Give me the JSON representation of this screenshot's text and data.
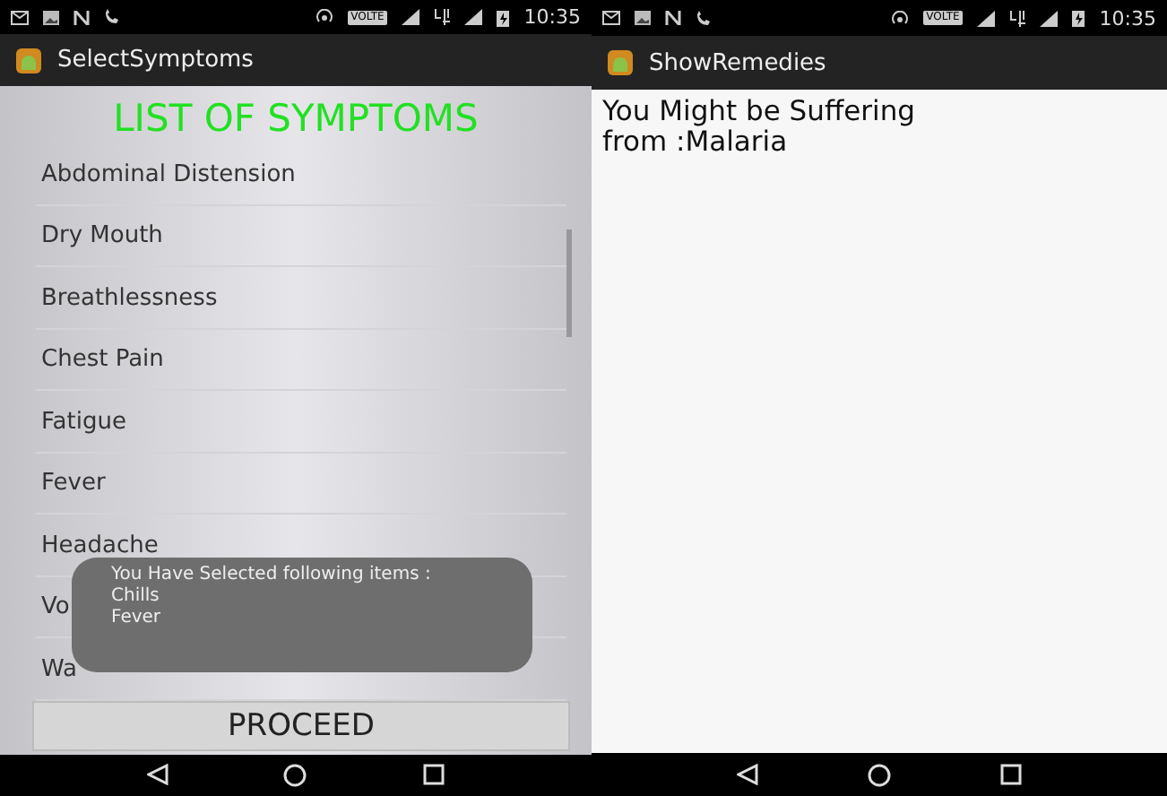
{
  "screens": [
    {
      "kind": "symptoms",
      "status_bar": {
        "badge": "VOLTE",
        "time": "10:35"
      },
      "app_bar": {
        "title": "SelectSymptoms"
      },
      "heading": "LIST OF SYMPTOMS",
      "items": [
        "Abdominal Distension",
        "Dry Mouth",
        "Breathlessness",
        "Chest Pain",
        "Fatigue",
        "Fever",
        "Headache",
        "Vo",
        "Wa"
      ],
      "toast": {
        "lines": [
          "You Have Selected following items  :",
          "Chills",
          "Fever"
        ]
      },
      "button": "PROCEED"
    },
    {
      "kind": "remedies",
      "status_bar": {
        "badge": "VOLTE",
        "time": "10:35"
      },
      "app_bar": {
        "title": "ShowRemedies"
      },
      "message": "You Might be Suffering from :Malaria"
    }
  ]
}
